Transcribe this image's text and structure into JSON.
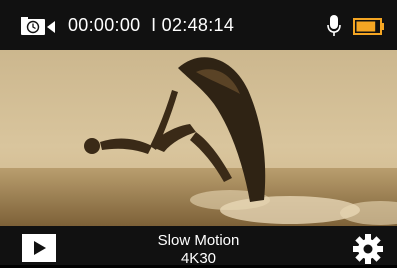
{
  "status": {
    "elapsed": "00:00:00",
    "remaining": "I 02:48:14",
    "mode_icon": "video-timer-icon",
    "audio_icon": "microphone-icon",
    "battery_icon": "battery-icon",
    "battery_level": 0.85
  },
  "bottom": {
    "play_icon": "playback-icon",
    "mode_title": "Slow Motion",
    "mode_sub": "4K30",
    "settings_icon": "gear-icon"
  },
  "colors": {
    "bar_bg": "#111111",
    "battery": "#f5a623",
    "text": "#ffffff"
  }
}
